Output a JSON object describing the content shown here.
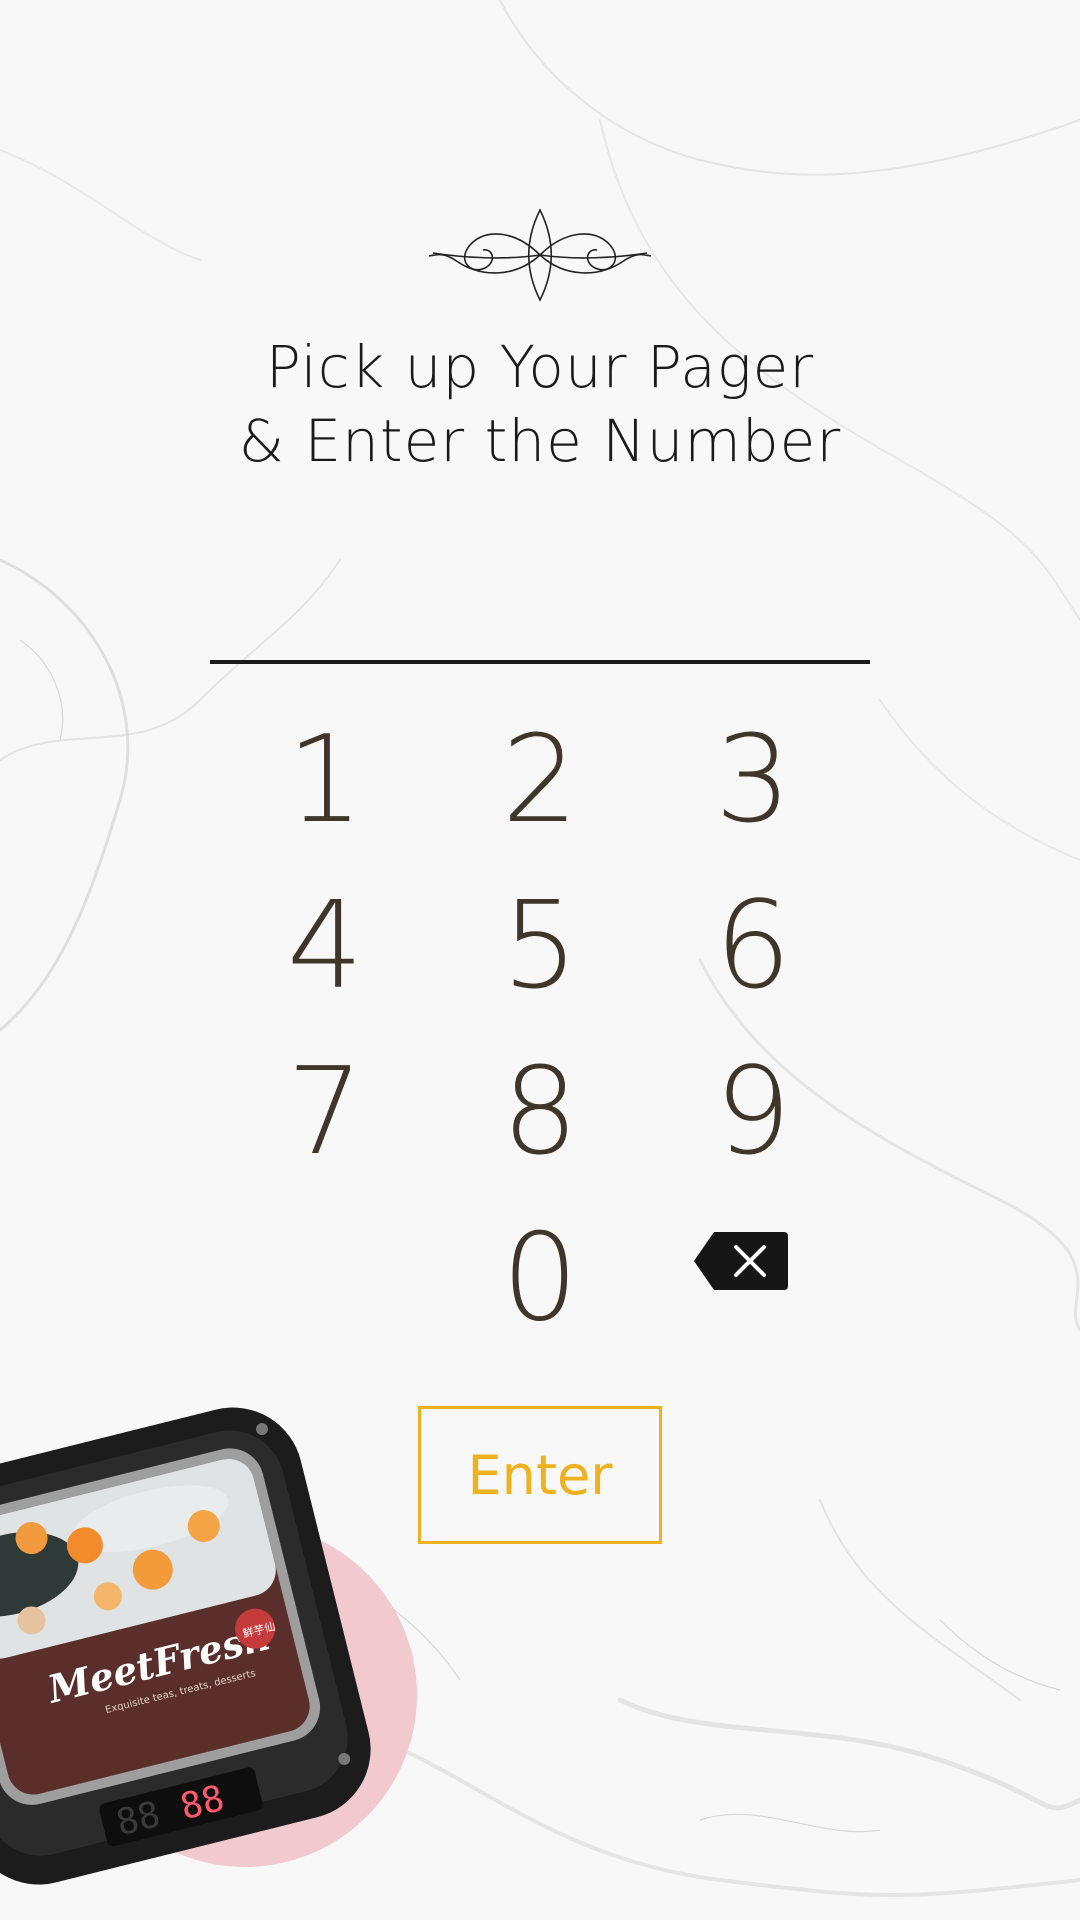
{
  "colors": {
    "digit": "#3f3529",
    "accent": "#f0b11e",
    "title": "#1a1a1a",
    "underline": "#1a1a1a",
    "pink_circle": "#f2c9cf",
    "pager_body": "#1f1f1f",
    "marble": "#f7f7f7"
  },
  "title": {
    "line1": "Pick up Your Pager",
    "line2": "& Enter the Number"
  },
  "number_field": {
    "value": "",
    "placeholder": ""
  },
  "keypad": {
    "keys": [
      "1",
      "2",
      "3",
      "4",
      "5",
      "6",
      "7",
      "8",
      "9",
      "0"
    ],
    "backspace_icon": "backspace-icon"
  },
  "enter_button": {
    "label": "Enter"
  },
  "pager": {
    "brand": "MeetFresh",
    "brand_cn": "鮮芋仙",
    "tagline": "Exquisite teas, treats, desserts",
    "display_digits": "88"
  },
  "decor": {
    "flourish_icon": "ornament-flourish-icon"
  }
}
